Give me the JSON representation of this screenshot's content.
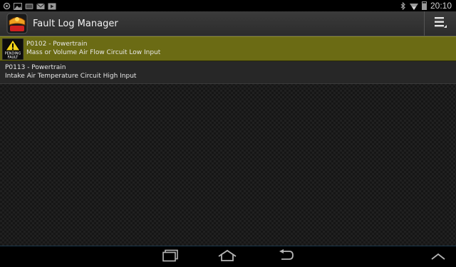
{
  "status_bar": {
    "time": "20:10",
    "left_icons": [
      "location-icon",
      "image-icon",
      "tablet-icon",
      "mail-icon",
      "play-store-icon"
    ],
    "right_icons": [
      "bluetooth-icon",
      "wifi-icon",
      "battery-icon"
    ]
  },
  "action_bar": {
    "title": "Fault Log Manager",
    "logo_text_top": "HOBDY",
    "logo_text_bottom": "CHECK",
    "menu_icon": "overflow-menu-icon"
  },
  "faults": [
    {
      "code_line": "P0102 - Powertrain",
      "description": "Mass or Volume Air Flow Circuit Low Input",
      "status": "pending",
      "badge_line1": "PENDING",
      "badge_line2": "FAULT"
    },
    {
      "code_line": "P0113 - Powertrain",
      "description": "Intake Air Temperature Circuit High Input",
      "status": "normal"
    }
  ],
  "nav_bar": {
    "buttons": [
      "recent-apps-icon",
      "home-icon",
      "back-icon",
      "collapse-up-icon"
    ]
  },
  "colors": {
    "pending_row": "#6b6b14",
    "normal_row": "#272727",
    "action_bar": "#333333"
  }
}
